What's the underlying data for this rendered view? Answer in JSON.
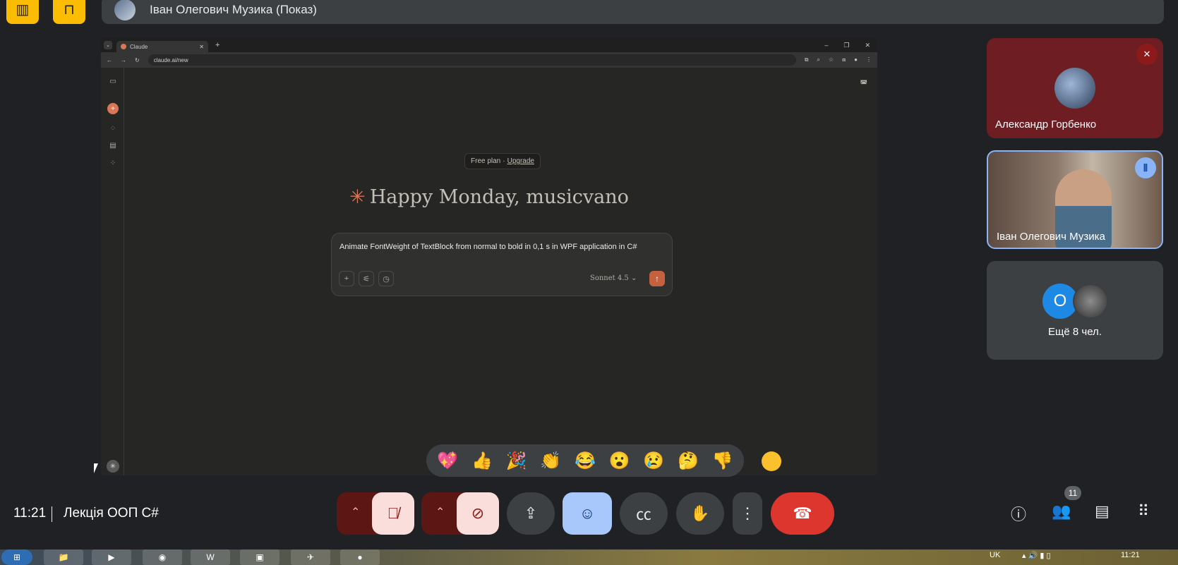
{
  "presenter": {
    "name": "Іван Олегович Музика (Показ)"
  },
  "browser": {
    "tab_title": "Claude",
    "url": "claude.ai/new"
  },
  "claude": {
    "plan_label": "Free plan",
    "plan_sep": "·",
    "upgrade_label": "Upgrade",
    "greeting": "Happy Monday, musicvano",
    "prompt": "Animate FontWeight of TextBlock from normal to bold in  0,1 s in  WPF application in C#",
    "model": "Sonnet 4.5"
  },
  "reactions": [
    "💖",
    "👍",
    "🎉",
    "👏",
    "😂",
    "😮",
    "😢",
    "🤔",
    "👎"
  ],
  "participants": {
    "tile1_name": "Александр Горбенко",
    "tile2_name": "Іван Олегович Музика",
    "tile3_initial": "O",
    "tile3_more": "Ещё 8 чел."
  },
  "bottom": {
    "time": "11:21",
    "meeting_title": "Лекція ООП C#",
    "people_count": "11"
  },
  "taskbar": {
    "lang": "UK",
    "time": "11:21"
  }
}
